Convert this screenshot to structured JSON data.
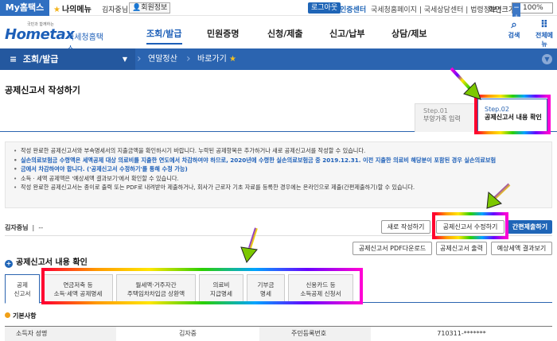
{
  "topbar": {
    "my_tab": "My홈택스",
    "my_menu": "나의메뉴",
    "user_name": "김자중님",
    "member_info": "회원정보",
    "logout": "로그아웃",
    "cert_center": "인증센터",
    "links": "국세청홈페이지 | 국세상담센터 | 법령정보 |",
    "zoom_label": "화면크기",
    "zoom_minus": "−",
    "zoom_value": "100%",
    "zoom_plus": "+"
  },
  "header": {
    "logo_small": "국민과 함께하는",
    "logo_main": "Hometax",
    "logo_sub": "국세청홈택스",
    "gnb": [
      "조회/발급",
      "민원증명",
      "신청/제출",
      "신고/납부",
      "상담/제보"
    ],
    "active_gnb_index": 0,
    "search_label": "검색",
    "allmenu_label": "전체메뉴"
  },
  "nav": {
    "menu": "조회/발급",
    "crumb1": "연말정산",
    "crumb2": "바로가기"
  },
  "page": {
    "title": "공제신고서 작성하기",
    "step1_num": "Step.01",
    "step1_label": "부양가족 입력",
    "step2_num": "Step.02",
    "step2_label": "공제신고서 내용 확인"
  },
  "notice": {
    "l1": "작성 완료한 공제신고서와 부속명세서의 지출금액을 확인하시기 바랍니다. 누락된 공제항목은 추가하거나 새로 공제신고서를 작성할 수 있습니다.",
    "l2": "실손의료보험금 수령액은 세액공제 대상 의료비를 지출한 연도에서 차감하여야 하므로, 2020년에 수령한 실손의료보험금 중 2019.12.31. 이전 지출한 의료비 해당분이 포함된 경우 실손의료보험",
    "l3": "금에서 차감하여야 합니다. ('공제신고서 수정하기'를 통해 수정 가능)",
    "l4": "소득 · 세액 공제액은 '예상세액 결과보기'에서 확인할 수 있습니다.",
    "l5": "작성 완료한 공제신고서는 종이로 출력 또는 PDF로 내려받아 제출하거나, 회사가 근로자 기초 자료를 등록한 경우에는 온라인으로 제출(간편제출하기)할 수 있습니다."
  },
  "userrow": {
    "name": "김자중님",
    "dash": "--",
    "btn_new": "새로 작성하기",
    "btn_edit": "공제신고서 수정하기",
    "btn_submit": "간편제출하기",
    "btn_pdf": "공제신고서 PDF다운로드",
    "btn_print": "공제신고서 출력",
    "btn_result": "예상세액 결과보기"
  },
  "section": {
    "title": "공제신고서 내용 확인",
    "tabs": [
      {
        "l1": "공제",
        "l2": "신고서"
      },
      {
        "l1": "연금저축 등",
        "l2": "소득·세액 공제명세"
      },
      {
        "l1": "월세액·거주자간",
        "l2": "주택임차차입금 상환액"
      },
      {
        "l1": "의료비",
        "l2": "지급명세"
      },
      {
        "l1": "기부금",
        "l2": "명세"
      },
      {
        "l1": "신용카드 등",
        "l2": "소득공제 신청서"
      }
    ]
  },
  "basic": {
    "title": "기본사항",
    "name_label": "소득자 성명",
    "name_value": "김자중",
    "rrn_label": "주민등록번호",
    "rrn_value": "710311-*******"
  }
}
